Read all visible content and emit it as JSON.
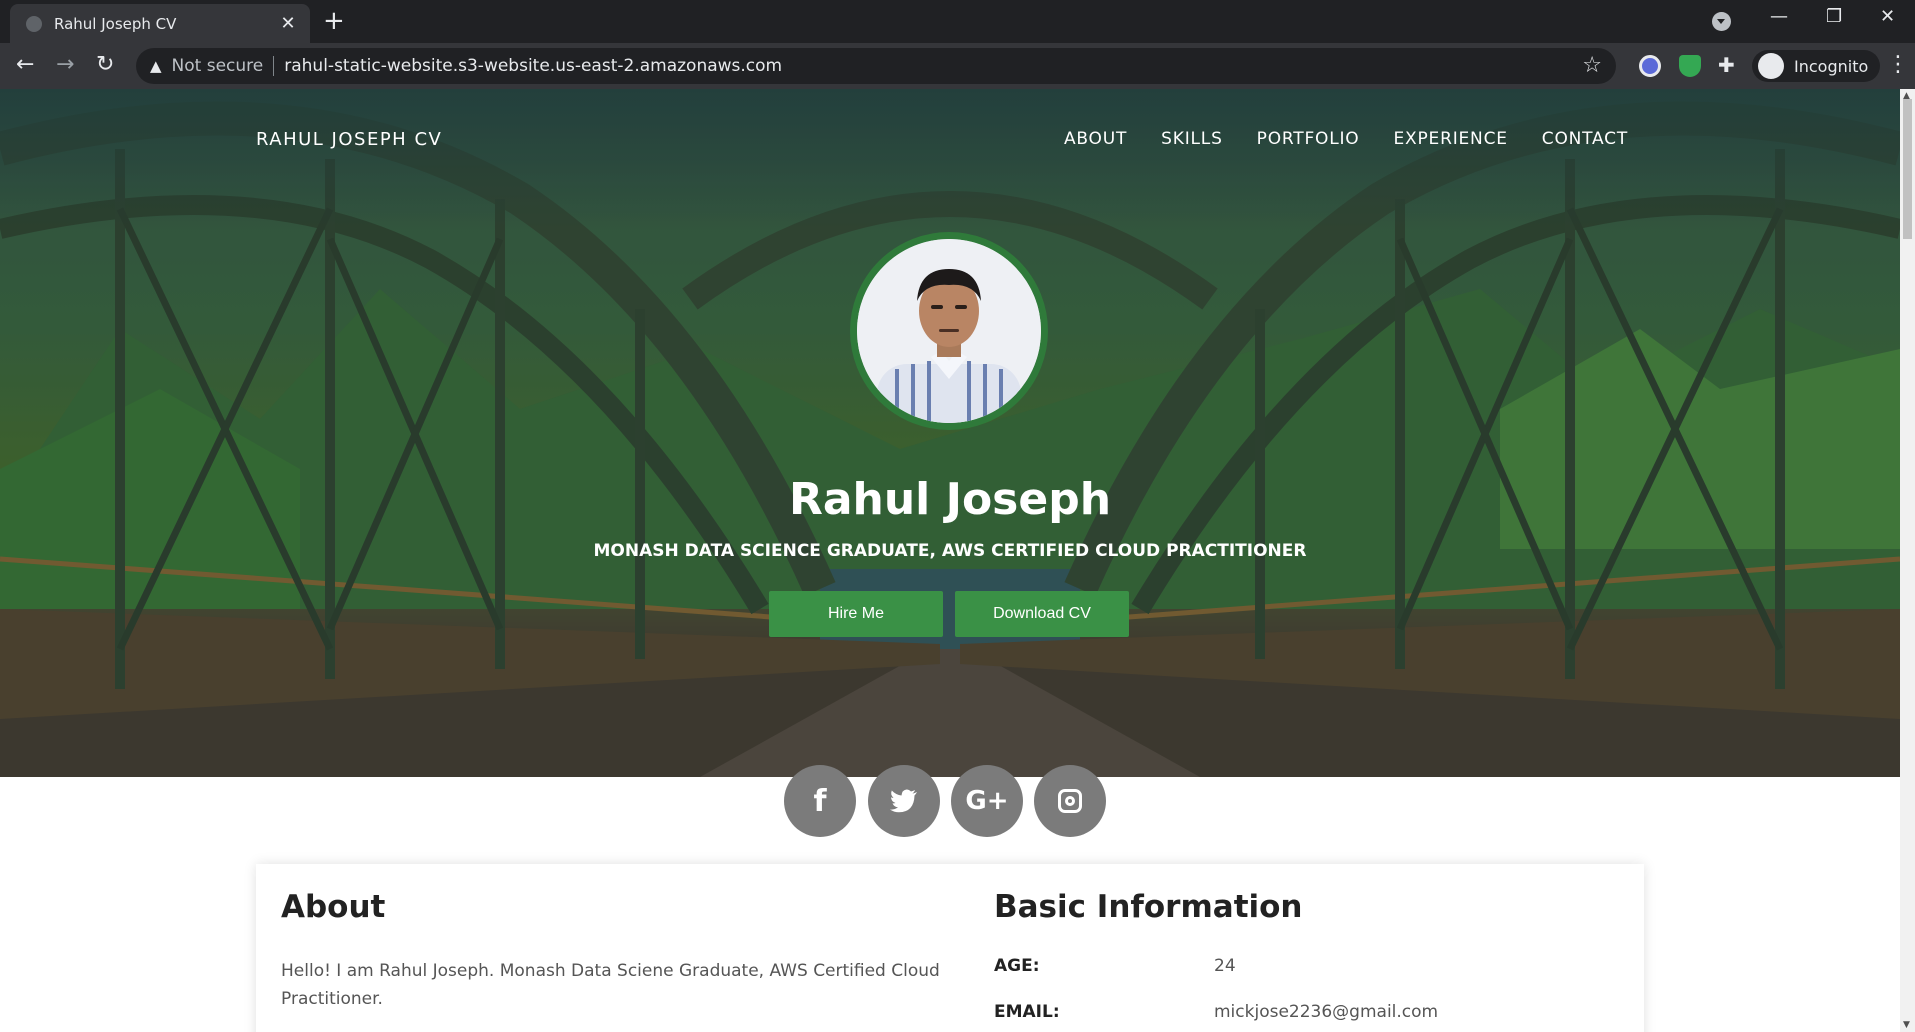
{
  "browser": {
    "tab_title": "Rahul Joseph CV",
    "tab_close": "✕",
    "new_tab": "+",
    "security_label": "Not secure",
    "url": "rahul-static-website.s3-website.us-east-2.amazonaws.com",
    "profile_label": "Incognito"
  },
  "site": {
    "brand": "RAHUL JOSEPH CV",
    "nav": [
      "ABOUT",
      "SKILLS",
      "PORTFOLIO",
      "EXPERIENCE",
      "CONTACT"
    ],
    "hero": {
      "name": "Rahul Joseph",
      "subtitle": "MONASH DATA SCIENCE GRADUATE, AWS CERTIFIED CLOUD PRACTITIONER",
      "hire_label": "Hire Me",
      "download_label": "Download CV"
    },
    "socials": [
      {
        "name": "facebook-icon",
        "glyph": "f"
      },
      {
        "name": "twitter-icon",
        "glyph": "🐦"
      },
      {
        "name": "google-plus-icon",
        "glyph": "G+"
      },
      {
        "name": "instagram-icon",
        "glyph": ""
      }
    ],
    "about": {
      "title": "About",
      "text": "Hello! I am Rahul Joseph. Monash Data Sciene Graduate, AWS Certified Cloud Practitioner."
    },
    "basic_info": {
      "title": "Basic Information",
      "rows": [
        {
          "label": "AGE:",
          "value": "24"
        },
        {
          "label": "EMAIL:",
          "value": "mickjose2236@gmail.com"
        }
      ]
    }
  },
  "colors": {
    "accent_green": "#3a9146",
    "social_gray": "#7b7b7b",
    "chrome_dark": "#202124"
  }
}
